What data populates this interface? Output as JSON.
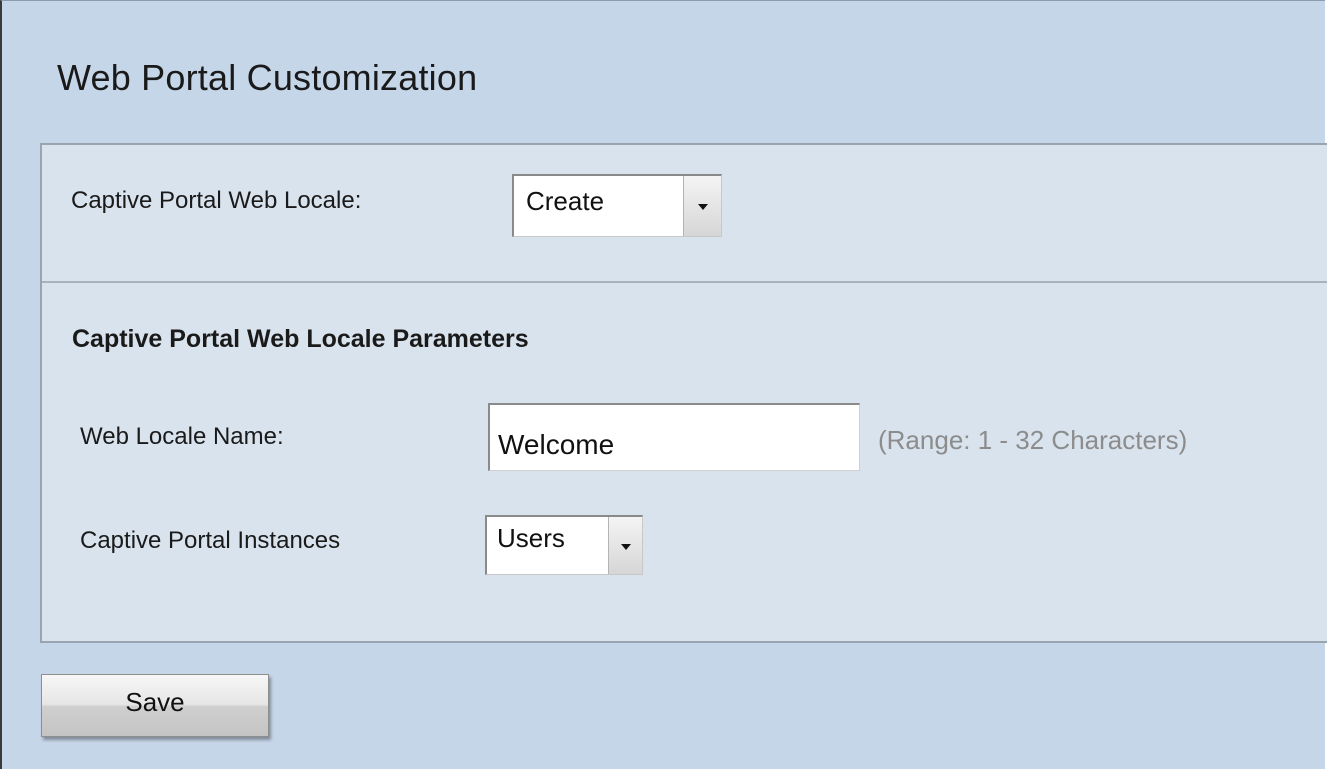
{
  "page": {
    "title": "Web Portal Customization"
  },
  "locale_row": {
    "label": "Captive Portal Web Locale:",
    "selected": "Create"
  },
  "parameters": {
    "heading": "Captive Portal Web Locale Parameters",
    "name_label": "Web Locale Name:",
    "name_value": "Welcome",
    "name_hint": "(Range: 1 - 32 Characters)",
    "instances_label": "Captive Portal Instances",
    "instances_selected": "Users"
  },
  "actions": {
    "save_label": "Save"
  },
  "colors": {
    "background": "#c6d6e9",
    "panel": "#d9e3ee",
    "hint_text": "#8c8c8c"
  },
  "icons": {
    "dropdown": "chevron-down-icon"
  }
}
